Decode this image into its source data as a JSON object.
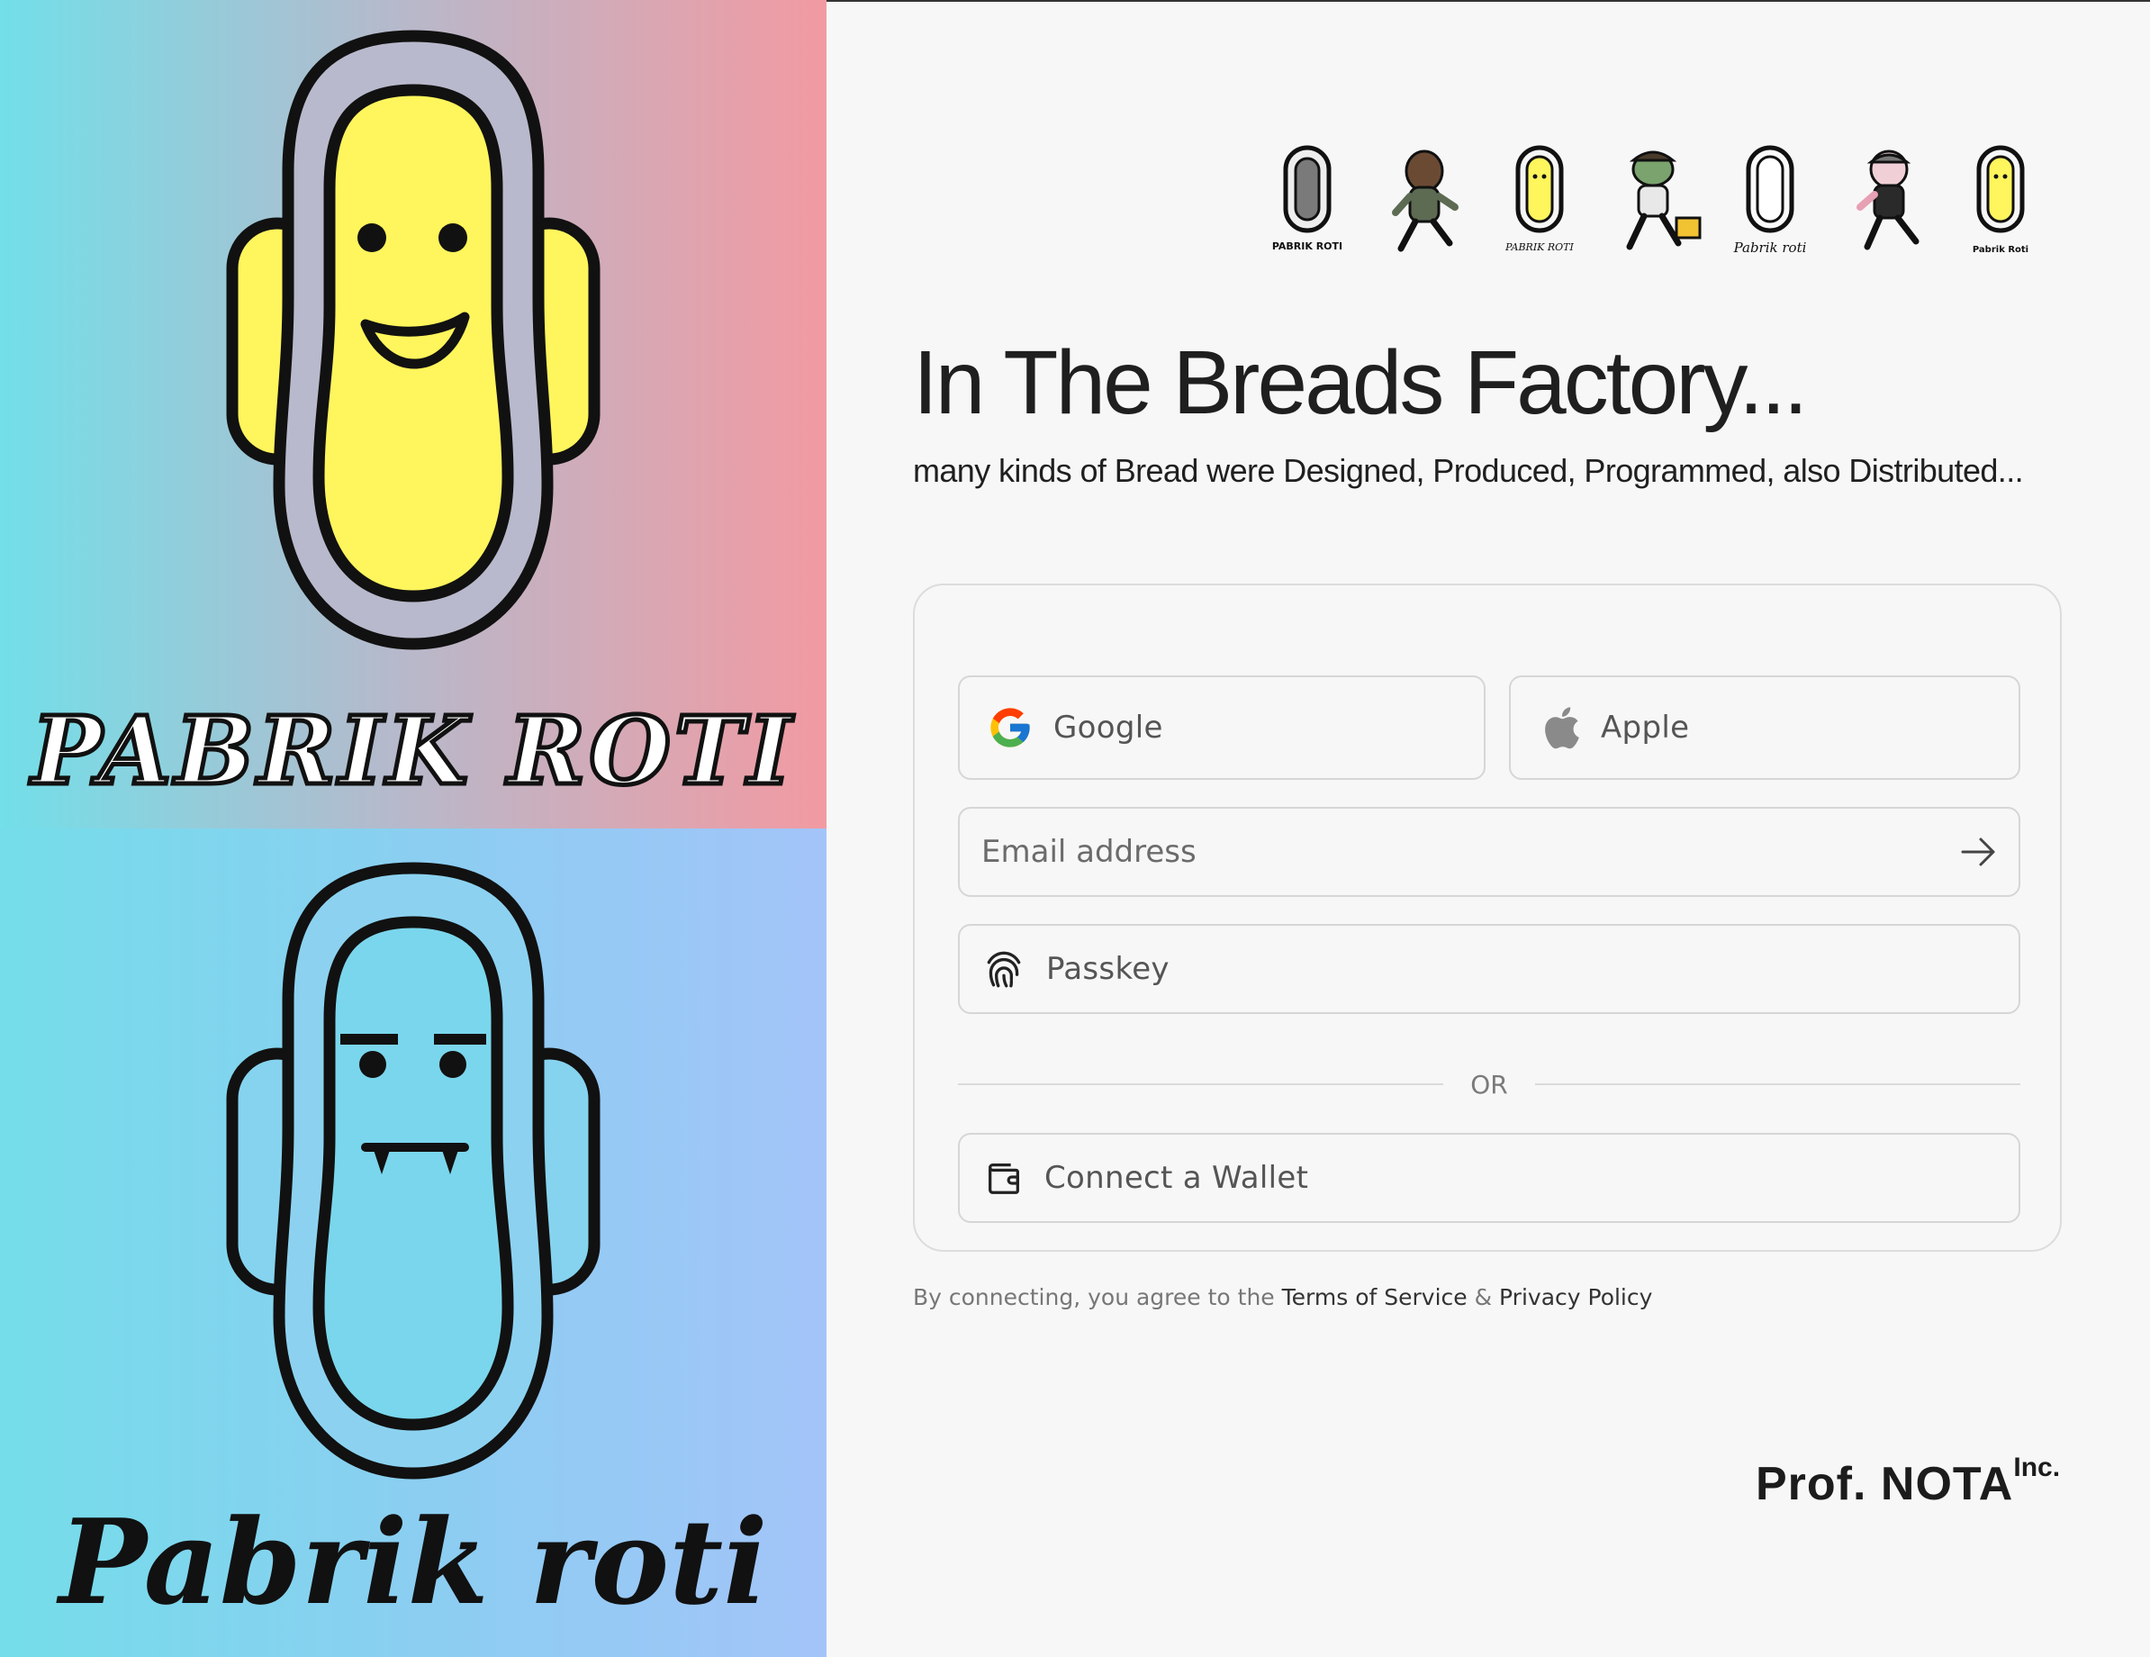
{
  "art": {
    "top_caption": "PABRIK ROTI",
    "bottom_caption": "Pabrik roti"
  },
  "mascots": [
    {
      "name": "PABRIK ROTI",
      "style": "silver"
    },
    {
      "name": "",
      "style": "runner-brown"
    },
    {
      "name": "PABRIK ROTI",
      "style": "yellow"
    },
    {
      "name": "",
      "style": "runner-green"
    },
    {
      "name": "Pabrik roti",
      "style": "white"
    },
    {
      "name": "",
      "style": "runner-pink"
    },
    {
      "name": "Pabrik Roti",
      "style": "yellow"
    }
  ],
  "hero": {
    "title": "In The Breads Factory...",
    "subtitle": "many kinds of Bread were Designed, Produced, Programmed, also Distributed..."
  },
  "login": {
    "google_label": "Google",
    "apple_label": "Apple",
    "email_placeholder": "Email address",
    "passkey_label": "Passkey",
    "divider_label": "OR",
    "wallet_label": "Connect a Wallet"
  },
  "legal": {
    "prefix": "By connecting, you agree to the ",
    "terms": "Terms of Service",
    "separator": " & ",
    "privacy": "Privacy Policy"
  },
  "brand": {
    "name": "Prof. NOTA",
    "suffix": "Inc."
  },
  "colors": {
    "page_bg": "#f7f7f7",
    "mascot_yellow": "#fff55c",
    "outline": "#111111",
    "border": "#d6d6d6",
    "text_dark": "#1f1f1f",
    "text_muted": "#6b6b6b"
  },
  "icons": {
    "google": "google-logo-icon",
    "apple": "apple-logo-icon",
    "email_submit": "arrow-right-icon",
    "passkey": "fingerprint-icon",
    "wallet": "wallet-icon"
  }
}
